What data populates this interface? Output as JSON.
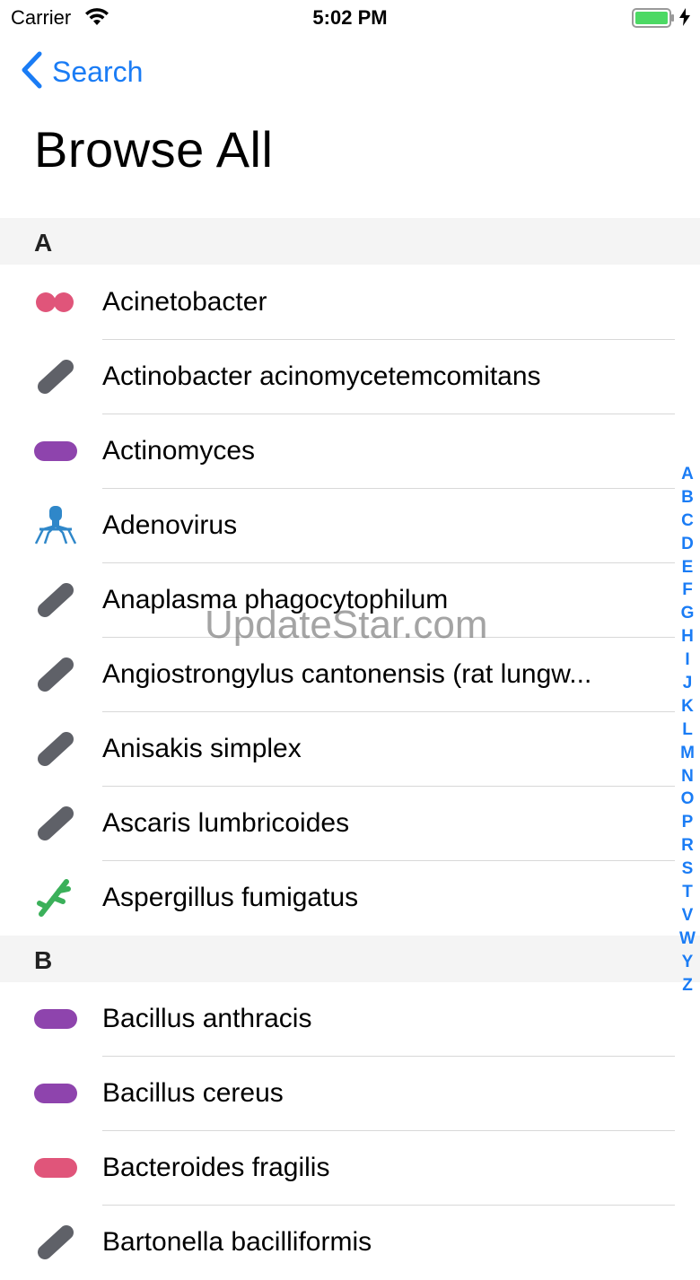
{
  "status_bar": {
    "carrier": "Carrier",
    "time": "5:02 PM"
  },
  "nav": {
    "back_label": "Search"
  },
  "page_title": "Browse All",
  "sections": [
    {
      "letter": "A",
      "items": [
        {
          "label": "Acinetobacter",
          "icon": "diplococcus-icon",
          "color": "#e0557a"
        },
        {
          "label": "Actinobacter acinomycetemcomitans",
          "icon": "rod-icon",
          "color": "#5f6168"
        },
        {
          "label": "Actinomyces",
          "icon": "bacillus-icon",
          "color": "#8e44ad"
        },
        {
          "label": "Adenovirus",
          "icon": "virus-icon",
          "color": "#2f87c9"
        },
        {
          "label": "Anaplasma phagocytophilum",
          "icon": "rod-icon",
          "color": "#5f6168"
        },
        {
          "label": "Angiostrongylus cantonensis (rat lungw...",
          "icon": "rod-icon",
          "color": "#5f6168"
        },
        {
          "label": "Anisakis simplex",
          "icon": "rod-icon",
          "color": "#5f6168"
        },
        {
          "label": "Ascaris lumbricoides",
          "icon": "rod-icon",
          "color": "#5f6168"
        },
        {
          "label": "Aspergillus fumigatus",
          "icon": "fungus-icon",
          "color": "#3bb05a"
        }
      ]
    },
    {
      "letter": "B",
      "items": [
        {
          "label": "Bacillus anthracis",
          "icon": "bacillus-icon",
          "color": "#8e44ad"
        },
        {
          "label": "Bacillus cereus",
          "icon": "bacillus-icon",
          "color": "#8e44ad"
        },
        {
          "label": "Bacteroides fragilis",
          "icon": "bacillus-icon",
          "color": "#e0557a"
        },
        {
          "label": "Bartonella bacilliformis",
          "icon": "rod-icon",
          "color": "#5f6168"
        }
      ]
    }
  ],
  "index_letters": [
    "A",
    "B",
    "C",
    "D",
    "E",
    "F",
    "G",
    "H",
    "I",
    "J",
    "K",
    "L",
    "M",
    "N",
    "O",
    "P",
    "R",
    "S",
    "T",
    "V",
    "W",
    "Y",
    "Z"
  ],
  "watermark": "UpdateStar.com",
  "colors": {
    "accent": "#1a7cf5",
    "section_bg": "#f4f4f4",
    "battery": "#4cd964"
  }
}
